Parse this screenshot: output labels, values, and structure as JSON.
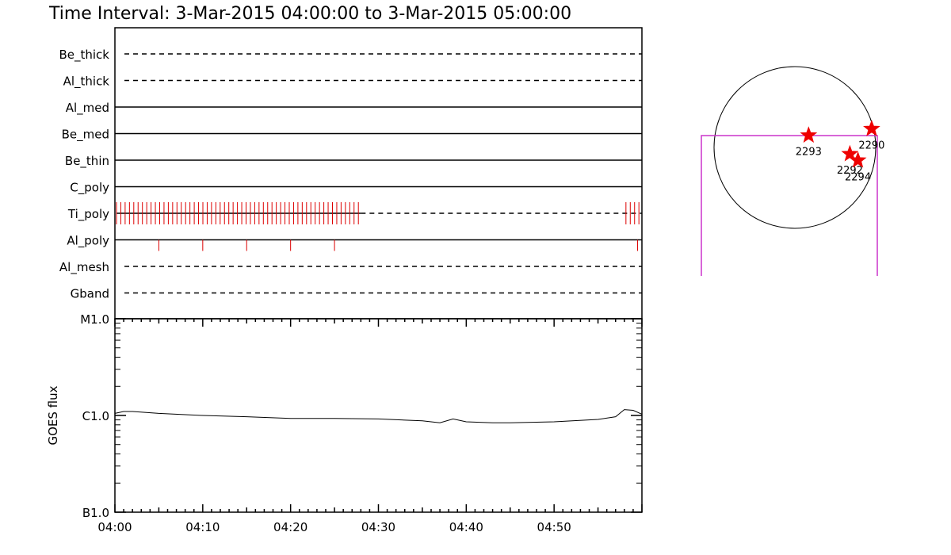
{
  "title": "Time Interval:  3-Mar-2015 04:00:00 to  3-Mar-2015 05:00:00",
  "chart_data": [
    {
      "type": "timeline",
      "xlim": [
        "04:00",
        "05:00"
      ],
      "rows": [
        {
          "label": "Be_thick",
          "style": "dashed",
          "ticks": []
        },
        {
          "label": "Al_thick",
          "style": "dashed",
          "ticks": []
        },
        {
          "label": "Al_med",
          "style": "solid",
          "ticks": []
        },
        {
          "label": "Be_med",
          "style": "solid",
          "ticks": []
        },
        {
          "label": "Be_thin",
          "style": "solid",
          "ticks": []
        },
        {
          "label": "C_poly",
          "style": "solid",
          "ticks": []
        },
        {
          "label": "Ti_poly",
          "style": "mixed",
          "solid_until": "04:28",
          "dense_tick_ranges": [
            [
              "04:00",
              "04:28"
            ],
            [
              "04:58",
              "05:00"
            ]
          ],
          "ticks": []
        },
        {
          "label": "Al_poly",
          "style": "solid",
          "ticks": [
            "04:05",
            "04:10",
            "04:15",
            "04:20",
            "04:25",
            "04:59.5"
          ]
        },
        {
          "label": "Al_mesh",
          "style": "dashed",
          "ticks": []
        },
        {
          "label": "Gband",
          "style": "dashed",
          "ticks": []
        }
      ],
      "tick_color": "#dd0000"
    },
    {
      "type": "line",
      "ylabel": "GOES flux",
      "yscale": "log",
      "y_ticks": [
        "B1.0",
        "C1.0",
        "M1.0"
      ],
      "ylim": [
        "B1.0",
        "M1.0"
      ],
      "x_ticks": [
        "04:00",
        "04:10",
        "04:20",
        "04:30",
        "04:40",
        "04:50"
      ],
      "series": [
        {
          "x": [
            "04:00",
            "04:01",
            "04:02",
            "04:05",
            "04:10",
            "04:15",
            "04:20",
            "04:25",
            "04:30",
            "04:35",
            "04:37",
            "04:38.5",
            "04:40",
            "04:43",
            "04:45",
            "04:50",
            "04:55",
            "04:57",
            "04:58",
            "04:59",
            "05:00"
          ],
          "y": [
            1.05e-06,
            1.1e-06,
            1.1e-06,
            1.05e-06,
            1e-06,
            9.7e-07,
            9.3e-07,
            9.3e-07,
            9.2e-07,
            8.8e-07,
            8.4e-07,
            9.2e-07,
            8.6e-07,
            8.4e-07,
            8.4e-07,
            8.6e-07,
            9.1e-07,
            9.7e-07,
            1.15e-06,
            1.13e-06,
            1.03e-06
          ],
          "color": "#000000"
        }
      ]
    },
    {
      "type": "scatter",
      "marker": "star",
      "marker_color": "#ee0000",
      "points": [
        {
          "label": "2290",
          "x": 0.95,
          "y": 0.23
        },
        {
          "label": "2293",
          "x": 0.17,
          "y": 0.15
        },
        {
          "label": "2292",
          "x": 0.68,
          "y": -0.08
        },
        {
          "label": "2294",
          "x": 0.78,
          "y": -0.16
        }
      ],
      "circle": {
        "r": 1.0
      },
      "box_color": "#cc33cc"
    }
  ]
}
